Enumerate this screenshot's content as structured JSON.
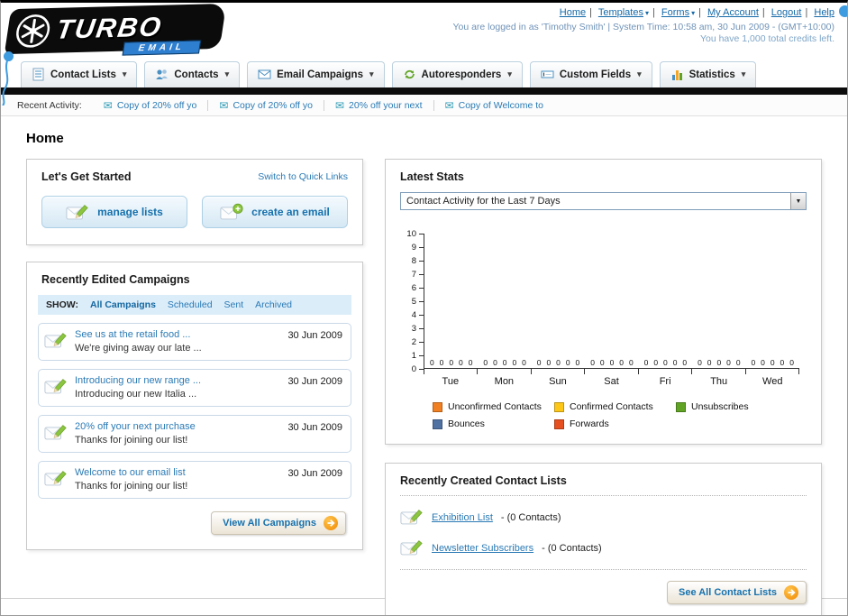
{
  "header": {
    "logo": {
      "title": "TURBO",
      "subtitle": "EMAIL"
    },
    "links": [
      "Home",
      "Templates",
      "Forms",
      "My Account",
      "Logout",
      "Help"
    ],
    "session_line": "You are logged in as 'Timothy Smith' | System Time: 10:58 am, 30 Jun 2009 - (GMT+10:00)",
    "credits_line": "You have 1,000 total credits left."
  },
  "nav": {
    "tabs": [
      {
        "label": "Contact Lists"
      },
      {
        "label": "Contacts"
      },
      {
        "label": "Email Campaigns"
      },
      {
        "label": "Autoresponders"
      },
      {
        "label": "Custom Fields"
      },
      {
        "label": "Statistics"
      }
    ]
  },
  "recent_activity": {
    "label": "Recent Activity:",
    "items": [
      {
        "text": "Copy of 20% off yo"
      },
      {
        "text": "Copy of 20% off yo"
      },
      {
        "text": "20% off your next"
      },
      {
        "text": "Copy of Welcome to"
      }
    ]
  },
  "page": {
    "title": "Home"
  },
  "get_started": {
    "title": "Let's Get Started",
    "switch_link": "Switch to Quick Links",
    "manage_lists_label": "manage lists",
    "create_email_label": "create an email"
  },
  "campaigns": {
    "title": "Recently Edited Campaigns",
    "show_label": "SHOW:",
    "filters": [
      "All Campaigns",
      "Scheduled",
      "Sent",
      "Archived"
    ],
    "active_filter": "All Campaigns",
    "items": [
      {
        "title": "See us at the retail food ...",
        "subtitle": "We're giving away our late ...",
        "date": "30 Jun 2009"
      },
      {
        "title": "Introducing our new range ...",
        "subtitle": "Introducing our new Italia ...",
        "date": "30 Jun 2009"
      },
      {
        "title": "20% off your next purchase",
        "subtitle": "Thanks for joining our list!",
        "date": "30 Jun 2009"
      },
      {
        "title": "Welcome to our email list",
        "subtitle": "Thanks for joining our list!",
        "date": "30 Jun 2009"
      }
    ],
    "view_all_label": "View All Campaigns"
  },
  "stats": {
    "title": "Latest Stats",
    "selected_option": "Contact Activity for the Last 7 Days",
    "chart_data": {
      "type": "bar",
      "title": "Contact Activity for the Last 7 Days",
      "categories": [
        "Tue",
        "Mon",
        "Sun",
        "Sat",
        "Fri",
        "Thu",
        "Wed"
      ],
      "series": [
        {
          "name": "Unconfirmed Contacts",
          "color": "#f08021",
          "values": [
            0,
            0,
            0,
            0,
            0,
            0,
            0
          ]
        },
        {
          "name": "Confirmed Contacts",
          "color": "#fdc718",
          "values": [
            0,
            0,
            0,
            0,
            0,
            0,
            0
          ]
        },
        {
          "name": "Unsubscribes",
          "color": "#61a425",
          "values": [
            0,
            0,
            0,
            0,
            0,
            0,
            0
          ]
        },
        {
          "name": "Bounces",
          "color": "#4f72a3",
          "values": [
            0,
            0,
            0,
            0,
            0,
            0,
            0
          ]
        },
        {
          "name": "Forwards",
          "color": "#e64f1f",
          "values": [
            0,
            0,
            0,
            0,
            0,
            0,
            0
          ]
        }
      ],
      "ylim": [
        0,
        10
      ],
      "ytick_step": 1,
      "grid": false,
      "legend_position": "bottom",
      "value_labels_shown": true
    }
  },
  "contact_lists": {
    "title": "Recently Created Contact Lists",
    "items": [
      {
        "name": "Exhibition List",
        "detail": "- (0 Contacts)"
      },
      {
        "name": "Newsletter Subscribers",
        "detail": "- (0 Contacts)"
      }
    ],
    "see_all_label": "See All Contact Lists"
  },
  "colors": {
    "link": "#2a7ab5",
    "accent_orange": "#f08a00",
    "nav_bar_black": "#0c0c0c"
  }
}
